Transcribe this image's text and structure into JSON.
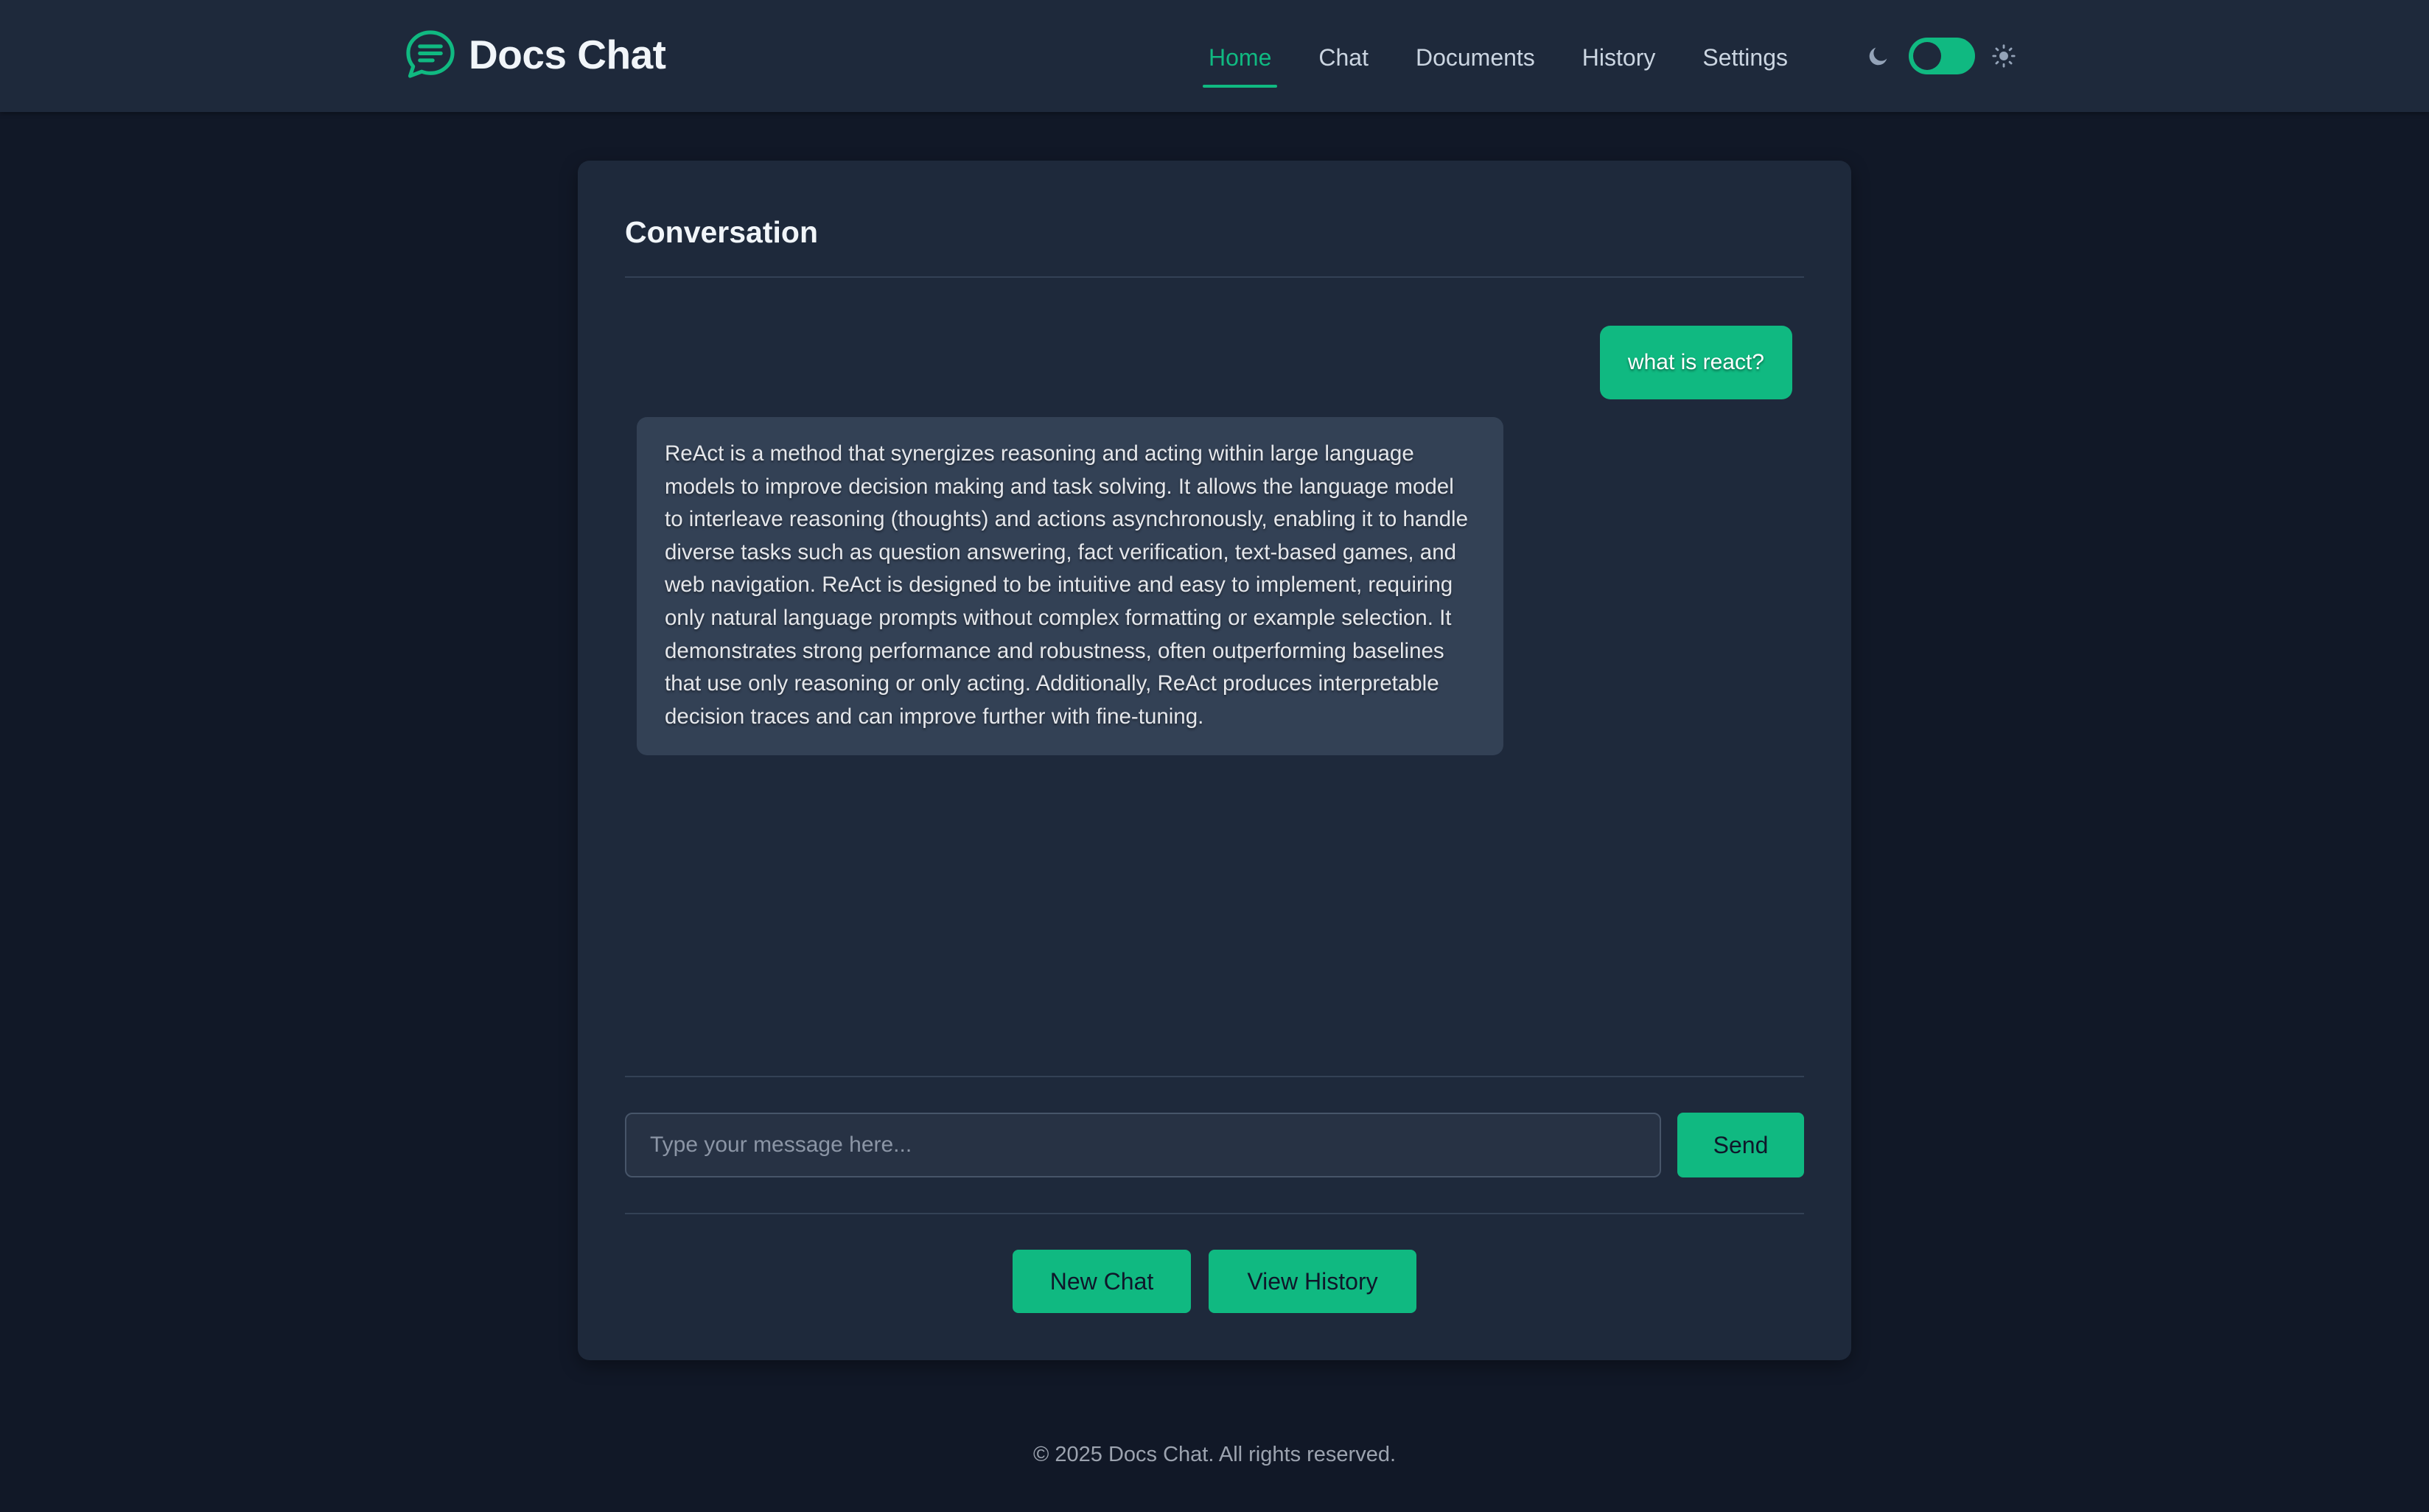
{
  "app": {
    "title": "Docs Chat",
    "accent_color": "#10b981",
    "background_color": "#111827",
    "panel_color": "#1e293b"
  },
  "nav": {
    "items": [
      {
        "label": "Home",
        "active": true
      },
      {
        "label": "Chat",
        "active": false
      },
      {
        "label": "Documents",
        "active": false
      },
      {
        "label": "History",
        "active": false
      },
      {
        "label": "Settings",
        "active": false
      }
    ]
  },
  "theme_toggle": {
    "left_icon": "moon-icon",
    "right_icon": "sun-icon",
    "mode": "dark"
  },
  "conversation": {
    "title": "Conversation",
    "messages": [
      {
        "role": "user",
        "text": "what is react?"
      },
      {
        "role": "assistant",
        "text": "ReAct is a method that synergizes reasoning and acting within large language models to improve decision making and task solving. It allows the language model to interleave reasoning (thoughts) and actions asynchronously, enabling it to handle diverse tasks such as question answering, fact verification, text-based games, and web navigation. ReAct is designed to be intuitive and easy to implement, requiring only natural language prompts without complex formatting or example selection. It demonstrates strong performance and robustness, often outperforming baselines that use only reasoning or only acting. Additionally, ReAct produces interpretable decision traces and can improve further with fine-tuning."
      }
    ]
  },
  "composer": {
    "placeholder": "Type your message here...",
    "value": "",
    "send_label": "Send"
  },
  "actions": {
    "new_chat_label": "New Chat",
    "view_history_label": "View History"
  },
  "footer": {
    "text": "© 2025 Docs Chat. All rights reserved."
  }
}
